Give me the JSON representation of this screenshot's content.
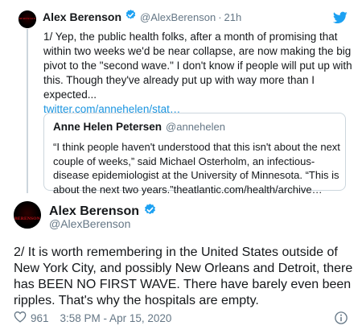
{
  "parent_tweet": {
    "author_name": "Alex Berenson",
    "handle": "@AlexBerenson",
    "time": "21h",
    "text": "1/ Yep, the public health folks, after a month of promising that within two weeks we'd be near collapse, are now making the big pivot to the \"second wave.\" I don't know if people will put up with this. Though they've already put up with way more than I expected...",
    "link": "twitter.com/annehelen/stat…",
    "avatar_text": "BERENSON"
  },
  "quoted_tweet": {
    "author_name": "Anne Helen Petersen",
    "handle": "@annehelen",
    "text": "“I think people haven't understood that this isn't about the next couple of weeks,” said Michael Osterholm, an infectious-disease epidemiologist at the University of Minnesota. “This is about the next two years.”theatlantic.com/health/archive…"
  },
  "main_tweet": {
    "author_name": "Alex Berenson",
    "handle": "@AlexBerenson",
    "avatar_text": "BERENSON",
    "text": "2/ It is worth remembering in the United States outside of New York City, and possibly New Orleans and Detroit, there has BEEN NO FIRST WAVE. There have barely even been ripples. That's why the hospitals are empty.",
    "likes": "961",
    "timestamp": "3:58 PM - Apr 15, 2020"
  },
  "icons": [
    "verified-badge-icon",
    "twitter-bird-icon",
    "heart-icon",
    "info-icon"
  ],
  "colors": {
    "link": "#1b95e0",
    "verified": "#1da1f2",
    "muted": "#657786",
    "border": "#ccd6dd"
  }
}
